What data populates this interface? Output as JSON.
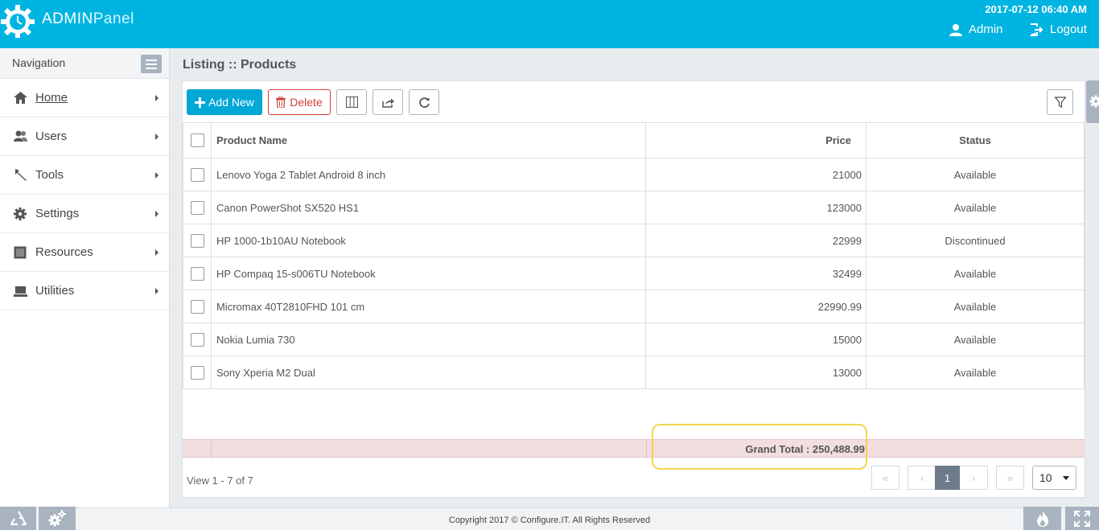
{
  "header": {
    "brand_bold": "ADMIN",
    "brand_light": "Panel",
    "datetime": "2017-07-12 06:40 AM",
    "user_label": "Admin",
    "logout_label": "Logout",
    "colors": {
      "header_bg": "#00b4e1",
      "accent": "#00a8d8",
      "danger": "#d43f3a",
      "total_row_bg": "#f2dede"
    }
  },
  "sidebar": {
    "title": "Navigation",
    "items": [
      {
        "label": "Home",
        "icon": "home-icon"
      },
      {
        "label": "Users",
        "icon": "users-icon"
      },
      {
        "label": "Tools",
        "icon": "tools-icon"
      },
      {
        "label": "Settings",
        "icon": "gear-icon"
      },
      {
        "label": "Resources",
        "icon": "resources-icon"
      },
      {
        "label": "Utilities",
        "icon": "laptop-icon"
      }
    ]
  },
  "main": {
    "title": "Listing :: Products",
    "toolbar": {
      "add_label": "Add New",
      "delete_label": "Delete"
    },
    "table": {
      "columns": [
        "Product Name",
        "Price",
        "Status"
      ],
      "rows": [
        {
          "name": "Lenovo Yoga 2 Tablet Android 8 inch",
          "price": "21000",
          "status": "Available"
        },
        {
          "name": "Canon PowerShot SX520 HS1",
          "price": "123000",
          "status": "Available"
        },
        {
          "name": "HP 1000-1b10AU Notebook",
          "price": "22999",
          "status": "Discontinued"
        },
        {
          "name": "HP Compaq 15-s006TU Notebook",
          "price": "32499",
          "status": "Available"
        },
        {
          "name": "Micromax 40T2810FHD 101 cm",
          "price": "22990.99",
          "status": "Available"
        },
        {
          "name": "Nokia Lumia 730",
          "price": "15000",
          "status": "Available"
        },
        {
          "name": "Sony Xperia M2 Dual",
          "price": "13000",
          "status": "Available"
        }
      ],
      "grand_total": "Grand Total : 250,488.99"
    },
    "pager": {
      "info": "View 1 - 7 of 7",
      "first": "«",
      "prev": "‹",
      "current": "1",
      "next": "›",
      "last": "»",
      "page_size": "10"
    }
  },
  "footer": {
    "copyright": "Copyright 2017 © Configure.IT. All Rights Reserved"
  }
}
